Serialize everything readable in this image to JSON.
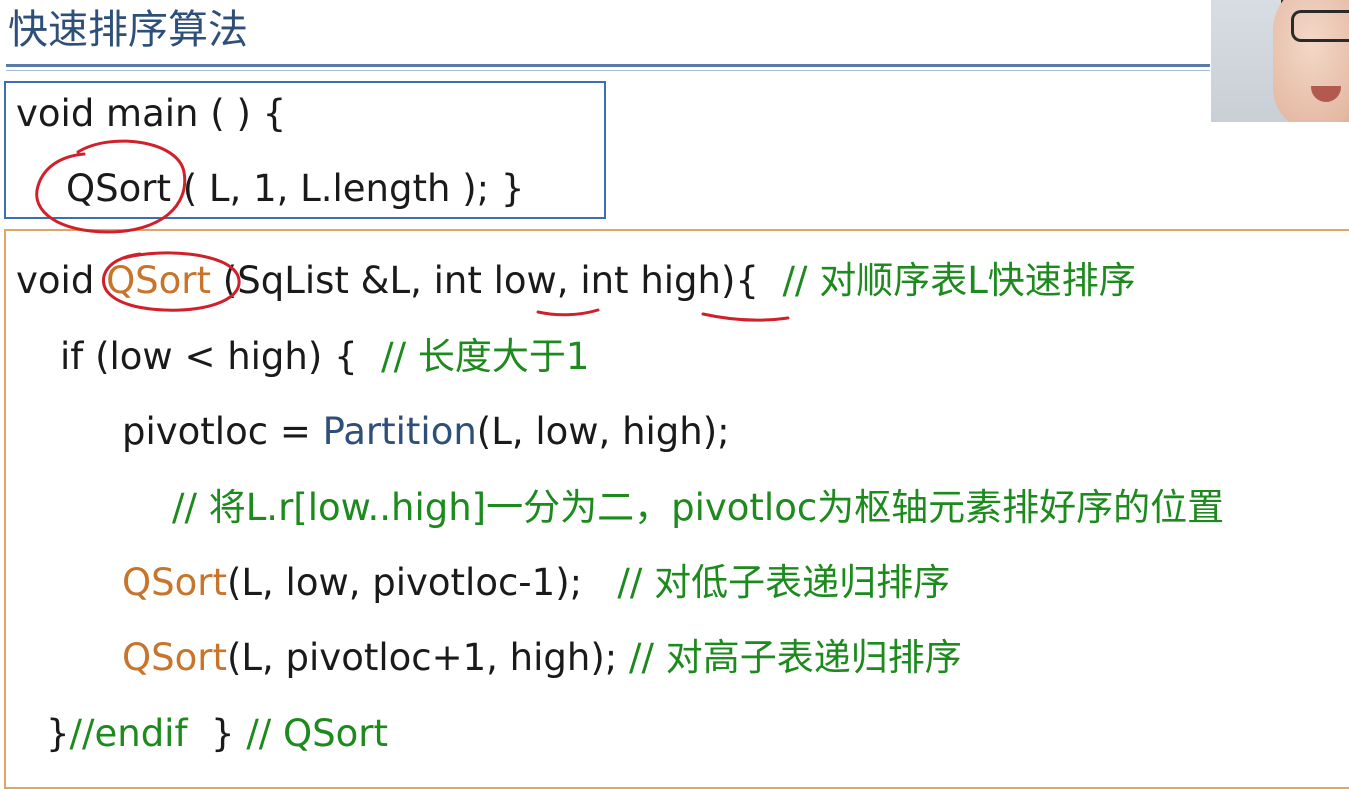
{
  "slide": {
    "title": "快速排序算法"
  },
  "main_box": {
    "line1": "void main ( ) {",
    "line2_fn": "QSort",
    "line2_rest": " ( L, 1, L.length ); }"
  },
  "code": {
    "l1_a": "void ",
    "l1_fn": "QSort",
    "l1_b": " (SqList &L, int low, int high){  ",
    "l1_cm": "// 对顺序表L快速排序",
    "l2_a": "if (low < high) {  ",
    "l2_cm": "// 长度大于1",
    "l3_a": "pivotloc = ",
    "l3_fn": "Partition",
    "l3_b": "(L, low, high);",
    "l4_cm": "// 将L.r[low..high]一分为二，pivotloc为枢轴元素排好序的位置",
    "l5_fn": "QSort",
    "l5_b": "(L, low, pivotloc-1);   ",
    "l5_cm": "// 对低子表递归排序",
    "l6_fn": "QSort",
    "l6_b": "(L, pivotloc+1, high); ",
    "l6_cm": "// 对高子表递归排序",
    "l7_a": "}",
    "l7_cm1": "//endif",
    "l7_b": "  } ",
    "l7_cm2": "// QSort"
  },
  "colors": {
    "title": "#2e4f7a",
    "function": "#c8742a",
    "partition": "#2e4f7a",
    "comment": "#1c8a1c",
    "annotation": "#d0202a",
    "main_box_border": "#3d6db5",
    "code_box_border": "#e0a466"
  }
}
